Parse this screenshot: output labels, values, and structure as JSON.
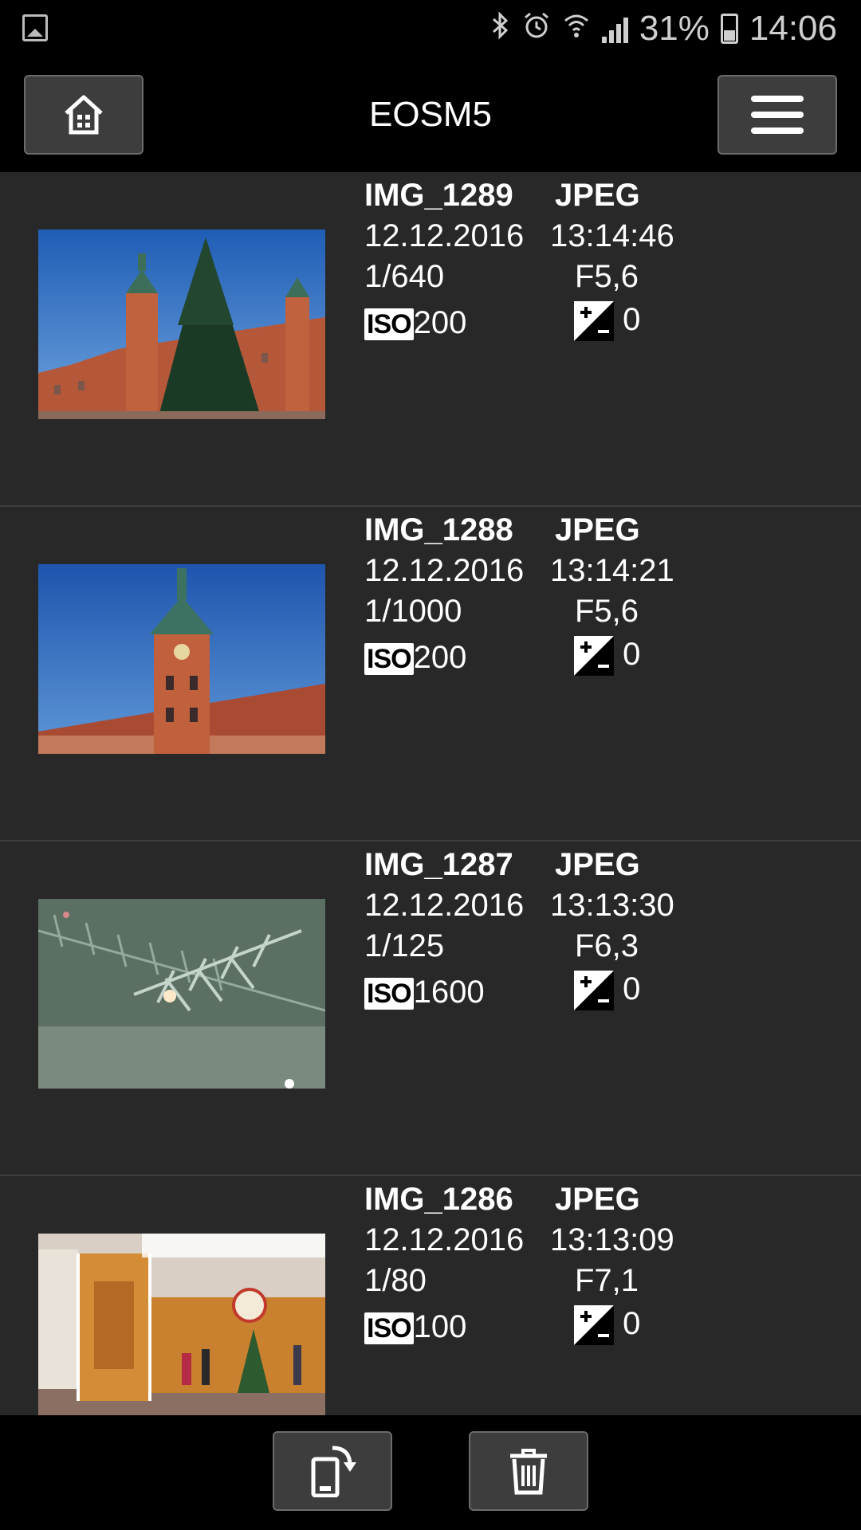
{
  "status_bar": {
    "battery_percent": "31%",
    "time": "14:06",
    "icons": [
      "gallery-icon",
      "bluetooth-icon",
      "alarm-icon",
      "wifi-icon",
      "signal-icon",
      "battery-icon"
    ]
  },
  "header": {
    "title": "EOSM5",
    "left_button_icon": "home-icon",
    "right_button_icon": "menu-icon"
  },
  "images": [
    {
      "name": "IMG_1289",
      "format": "JPEG",
      "date": "12.12.2016",
      "time": "13:14:46",
      "shutter": "1/640",
      "aperture": "F5,6",
      "iso_label": "ISO",
      "iso": "200",
      "exposure_comp": "0",
      "thumbnail": "castle-with-christmas-tree"
    },
    {
      "name": "IMG_1288",
      "format": "JPEG",
      "date": "12.12.2016",
      "time": "13:14:21",
      "shutter": "1/1000",
      "aperture": "F5,6",
      "iso_label": "ISO",
      "iso": "200",
      "exposure_comp": "0",
      "thumbnail": "castle-clock-tower"
    },
    {
      "name": "IMG_1287",
      "format": "JPEG",
      "date": "12.12.2016",
      "time": "13:13:30",
      "shutter": "1/125",
      "aperture": "F6,3",
      "iso_label": "ISO",
      "iso": "1600",
      "exposure_comp": "0",
      "thumbnail": "spruce-branch-closeup"
    },
    {
      "name": "IMG_1286",
      "format": "JPEG",
      "date": "12.12.2016",
      "time": "13:13:09",
      "shutter": "1/80",
      "aperture": "F7,1",
      "iso_label": "ISO",
      "iso": "100",
      "exposure_comp": "0",
      "thumbnail": "christmas-market-stall"
    }
  ],
  "bottom_bar": {
    "buttons": [
      "transfer-to-phone-icon",
      "trash-icon"
    ]
  },
  "colors": {
    "background": "#282828",
    "bar_background": "#000000",
    "button_background": "#3d3d3d",
    "text": "#ffffff"
  }
}
